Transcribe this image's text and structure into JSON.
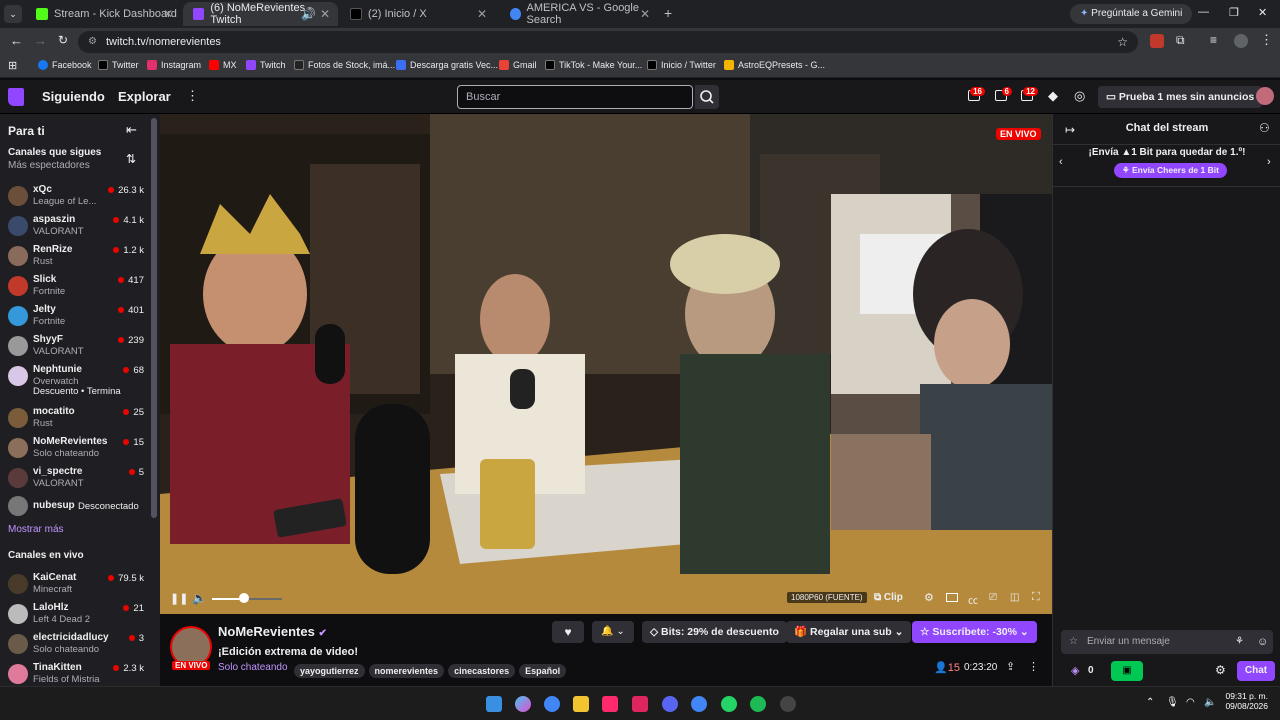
{
  "browser": {
    "tabs": [
      {
        "title": "Stream - Kick Dashboard",
        "color": "#53fc18"
      },
      {
        "title": "(6) NoMeRevientes - Twitch",
        "color": "#9146ff"
      },
      {
        "title": "(2) Inicio / X",
        "color": "#000000"
      },
      {
        "title": "AMERICA VS - Google Search",
        "color": "#4285f4"
      }
    ],
    "gemini_label": "Pregúntale a Gemini",
    "url": "twitch.tv/nomerevientes",
    "bookmarks": [
      "Facebook",
      "Twitter",
      "Instagram",
      "MX",
      "Twitch",
      "Fotos de Stock, imá...",
      "Descarga gratis Vec...",
      "Gmail",
      "TikTok - Make Your...",
      "Inicio / Twitter",
      "AstroEQPresets - G..."
    ]
  },
  "topnav": {
    "following": "Siguiendo",
    "browse": "Explorar",
    "search_placeholder": "Buscar",
    "badge_inbox": "16",
    "badge_whispers": "6",
    "badge_notif": "12",
    "turbo": "Prueba 1 mes sin anuncios"
  },
  "sidebar": {
    "for_you": "Para ti",
    "followed_title": "Canales que sigues",
    "followed_sort": "Más espectadores",
    "followed": [
      {
        "name": "xQc",
        "game": "League of Le...",
        "viewers": "26.3 k",
        "color": "#6b4f3a"
      },
      {
        "name": "aspaszin",
        "game": "VALORANT",
        "viewers": "4.1 k",
        "color": "#3a4a6b"
      },
      {
        "name": "RenRize",
        "game": "Rust",
        "viewers": "1.2 k",
        "color": "#8a6a5a"
      },
      {
        "name": "Slick",
        "game": "Fortnite",
        "viewers": "417",
        "color": "#c0392b"
      },
      {
        "name": "Jelty",
        "game": "Fortnite",
        "viewers": "401",
        "color": "#3498db"
      },
      {
        "name": "ShyyF",
        "game": "VALORANT",
        "viewers": "239",
        "color": "#999999"
      },
      {
        "name": "Nephtunie",
        "game": "Overwatch",
        "viewers": "68",
        "color": "#d9c7e8"
      },
      {
        "name": "mocatito",
        "game": "Rust",
        "viewers": "25",
        "color": "#7a5c3a"
      },
      {
        "name": "NoMeRevientes",
        "game": "Solo chateando",
        "viewers": "15",
        "color": "#8b6f5a"
      },
      {
        "name": "vi_spectre",
        "game": "VALORANT",
        "viewers": "5",
        "color": "#5a3a3a"
      }
    ],
    "nephtunie_tags": "Descuento • Termina",
    "offline": {
      "name": "nubesup",
      "status": "Desconectado"
    },
    "show_more": "Mostrar más",
    "live_title": "Canales en vivo",
    "live": [
      {
        "name": "KaiCenat",
        "game": "Minecraft",
        "viewers": "79.5 k",
        "color": "#4a3a2a"
      },
      {
        "name": "LaloHlz",
        "game": "Left 4 Dead 2",
        "viewers": "21",
        "color": "#bbbbbb"
      },
      {
        "name": "electricidadlucy",
        "game": "Solo chateando",
        "viewers": "3",
        "color": "#6a5a4a"
      },
      {
        "name": "TinaKitten",
        "game": "Fields of Mistria",
        "viewers": "2.3 k",
        "color": "#e07a9a"
      }
    ]
  },
  "player": {
    "live_badge": "EN VIVO",
    "quality": "1080P60 (FUENTE)",
    "clip": "Clip",
    "volume": 0.45
  },
  "stream": {
    "channel": "NoMeRevientes",
    "title": "¡Edición extrema de video!",
    "category": "Solo chateando",
    "live_badge": "EN VIVO",
    "tags": [
      "yayogutierrez",
      "nomerevientes",
      "cinecastores",
      "Español"
    ],
    "bits_label": "Bits: 29% de descuento",
    "gift_label": "Regalar una sub",
    "sub_label": "Suscríbete: -30%",
    "viewers": "15",
    "uptime": "0:23:20"
  },
  "chat": {
    "title": "Chat del stream",
    "bits_promo": "¡Envía ▲1 Bit para quedar de 1.º!",
    "cheers_button": "Envía Cheers de 1 Bit",
    "input_placeholder": "Enviar un mensaje",
    "points": "0",
    "send": "Chat"
  },
  "taskbar": {
    "time": "09:31 p. m.",
    "date": "09/08/2026"
  }
}
